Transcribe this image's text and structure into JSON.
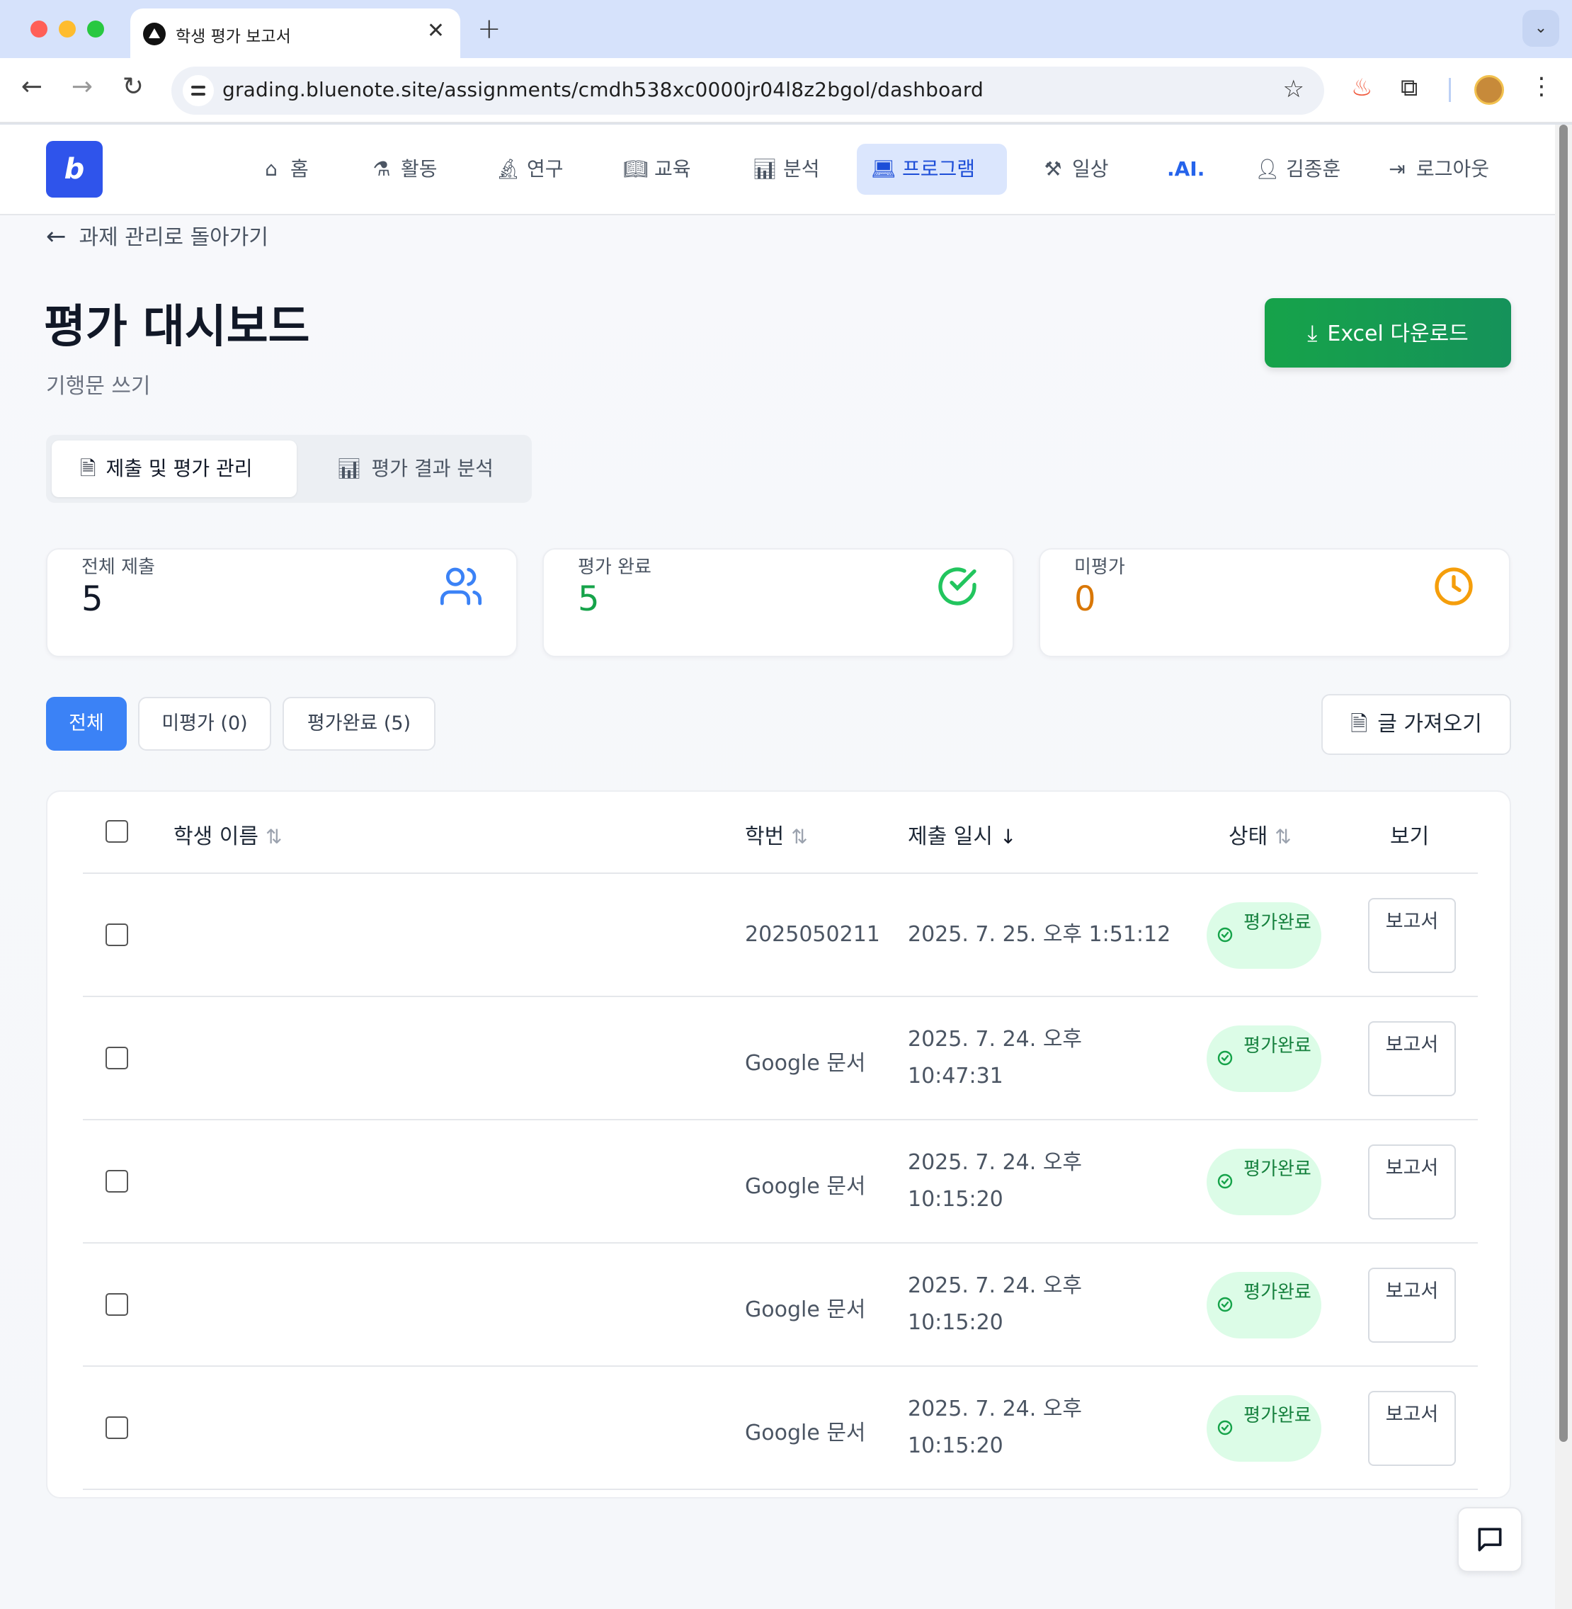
{
  "browser": {
    "tab_title": "학생 평가 보고서",
    "url": "grading.bluenote.site/assignments/cmdh538xc0000jr04l8z2bgol/dashboard"
  },
  "header": {
    "logo": "b",
    "nav": [
      {
        "label": "홈",
        "icon": "home-icon"
      },
      {
        "label": "활동",
        "icon": "flask-icon"
      },
      {
        "label": "연구",
        "icon": "microscope-icon"
      },
      {
        "label": "교육",
        "icon": "book-icon"
      },
      {
        "label": "분석",
        "icon": "bar-chart-icon"
      },
      {
        "label": "프로그램",
        "icon": "laptop-icon",
        "active": true
      },
      {
        "label": "일상",
        "icon": "hammer-icon"
      },
      {
        "label": ".AI."
      },
      {
        "label": "김종훈",
        "icon": "user-icon"
      },
      {
        "label": "로그아웃",
        "icon": "logout-icon"
      }
    ]
  },
  "back_link": "과제 관리로 돌아가기",
  "page": {
    "title": "평가 대시보드",
    "subtitle": "기행문 쓰기",
    "excel_button": "Excel 다운로드"
  },
  "tabs": [
    {
      "label": "제출 및 평가 관리",
      "active": true
    },
    {
      "label": "평가 결과 분석",
      "active": false
    }
  ],
  "stats": [
    {
      "label": "전체 제출",
      "value": "5",
      "color": "#111827",
      "icon": "users-icon",
      "icon_color": "#3b82f6"
    },
    {
      "label": "평가 완료",
      "value": "5",
      "color": "#16a34a",
      "icon": "check-circle-icon",
      "icon_color": "#22c55e"
    },
    {
      "label": "미평가",
      "value": "0",
      "color": "#d97706",
      "icon": "clock-icon",
      "icon_color": "#f59e0b"
    }
  ],
  "filters": [
    {
      "label": "전체",
      "active": true
    },
    {
      "label": "미평가 (0)",
      "active": false
    },
    {
      "label": "평가완료 (5)",
      "active": false
    }
  ],
  "import_button": "글 가져오기",
  "table": {
    "columns": {
      "name": "학생 이름",
      "id": "학번",
      "date": "제출 일시",
      "status": "상태",
      "view": "보기"
    },
    "rows": [
      {
        "name": "",
        "id": "2025050211",
        "date": "2025. 7. 25. 오후 1:51:12",
        "status": "평가완료",
        "view": "보고서"
      },
      {
        "name": "",
        "id": "Google 문서",
        "date": "2025. 7. 24. 오후 10:47:31",
        "status": "평가완료",
        "view": "보고서"
      },
      {
        "name": "",
        "id": "Google 문서",
        "date": "2025. 7. 24. 오후 10:15:20",
        "status": "평가완료",
        "view": "보고서"
      },
      {
        "name": "",
        "id": "Google 문서",
        "date": "2025. 7. 24. 오후 10:15:20",
        "status": "평가완료",
        "view": "보고서"
      },
      {
        "name": "",
        "id": "Google 문서",
        "date": "2025. 7. 24. 오후 10:15:20",
        "status": "평가완료",
        "view": "보고서"
      }
    ]
  },
  "colors": {
    "primary": "#3b82f6",
    "success": "#16a34a",
    "warning": "#d97706",
    "nav_active_bg": "#dbe6fd"
  }
}
